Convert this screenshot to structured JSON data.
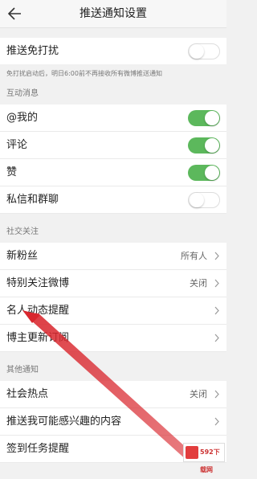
{
  "header": {
    "title": "推送通知设置",
    "back_icon": "back-arrow-icon"
  },
  "dnd": {
    "label": "推送免打扰",
    "enabled": false,
    "hint": "免打扰启动后，明日6:00前不再接收所有微博推送通知"
  },
  "sections": {
    "interaction": "互动消息",
    "social": "社交关注",
    "other": "其他通知"
  },
  "interaction": {
    "mentions": {
      "label": "@我的",
      "enabled": true
    },
    "comments": {
      "label": "评论",
      "enabled": true
    },
    "likes": {
      "label": "赞",
      "enabled": true
    },
    "messages": {
      "label": "私信和群聊",
      "enabled": false
    }
  },
  "social": {
    "new_fans": {
      "label": "新粉丝",
      "value": "所有人"
    },
    "special_follow": {
      "label": "特别关注微博",
      "value": "关闭"
    },
    "celebrity": {
      "label": "名人动态提醒"
    },
    "blogger_sub": {
      "label": "博主更新订阅"
    }
  },
  "other": {
    "hot": {
      "label": "社会热点",
      "value": "关闭"
    },
    "interest": {
      "label": "推送我可能感兴趣的内容"
    },
    "checkin": {
      "label": "签到任务提醒"
    }
  },
  "watermark": {
    "text": "592下载网"
  },
  "colors": {
    "toggle_on": "#5cb85c",
    "annotation_arrow": "#d9272e"
  }
}
